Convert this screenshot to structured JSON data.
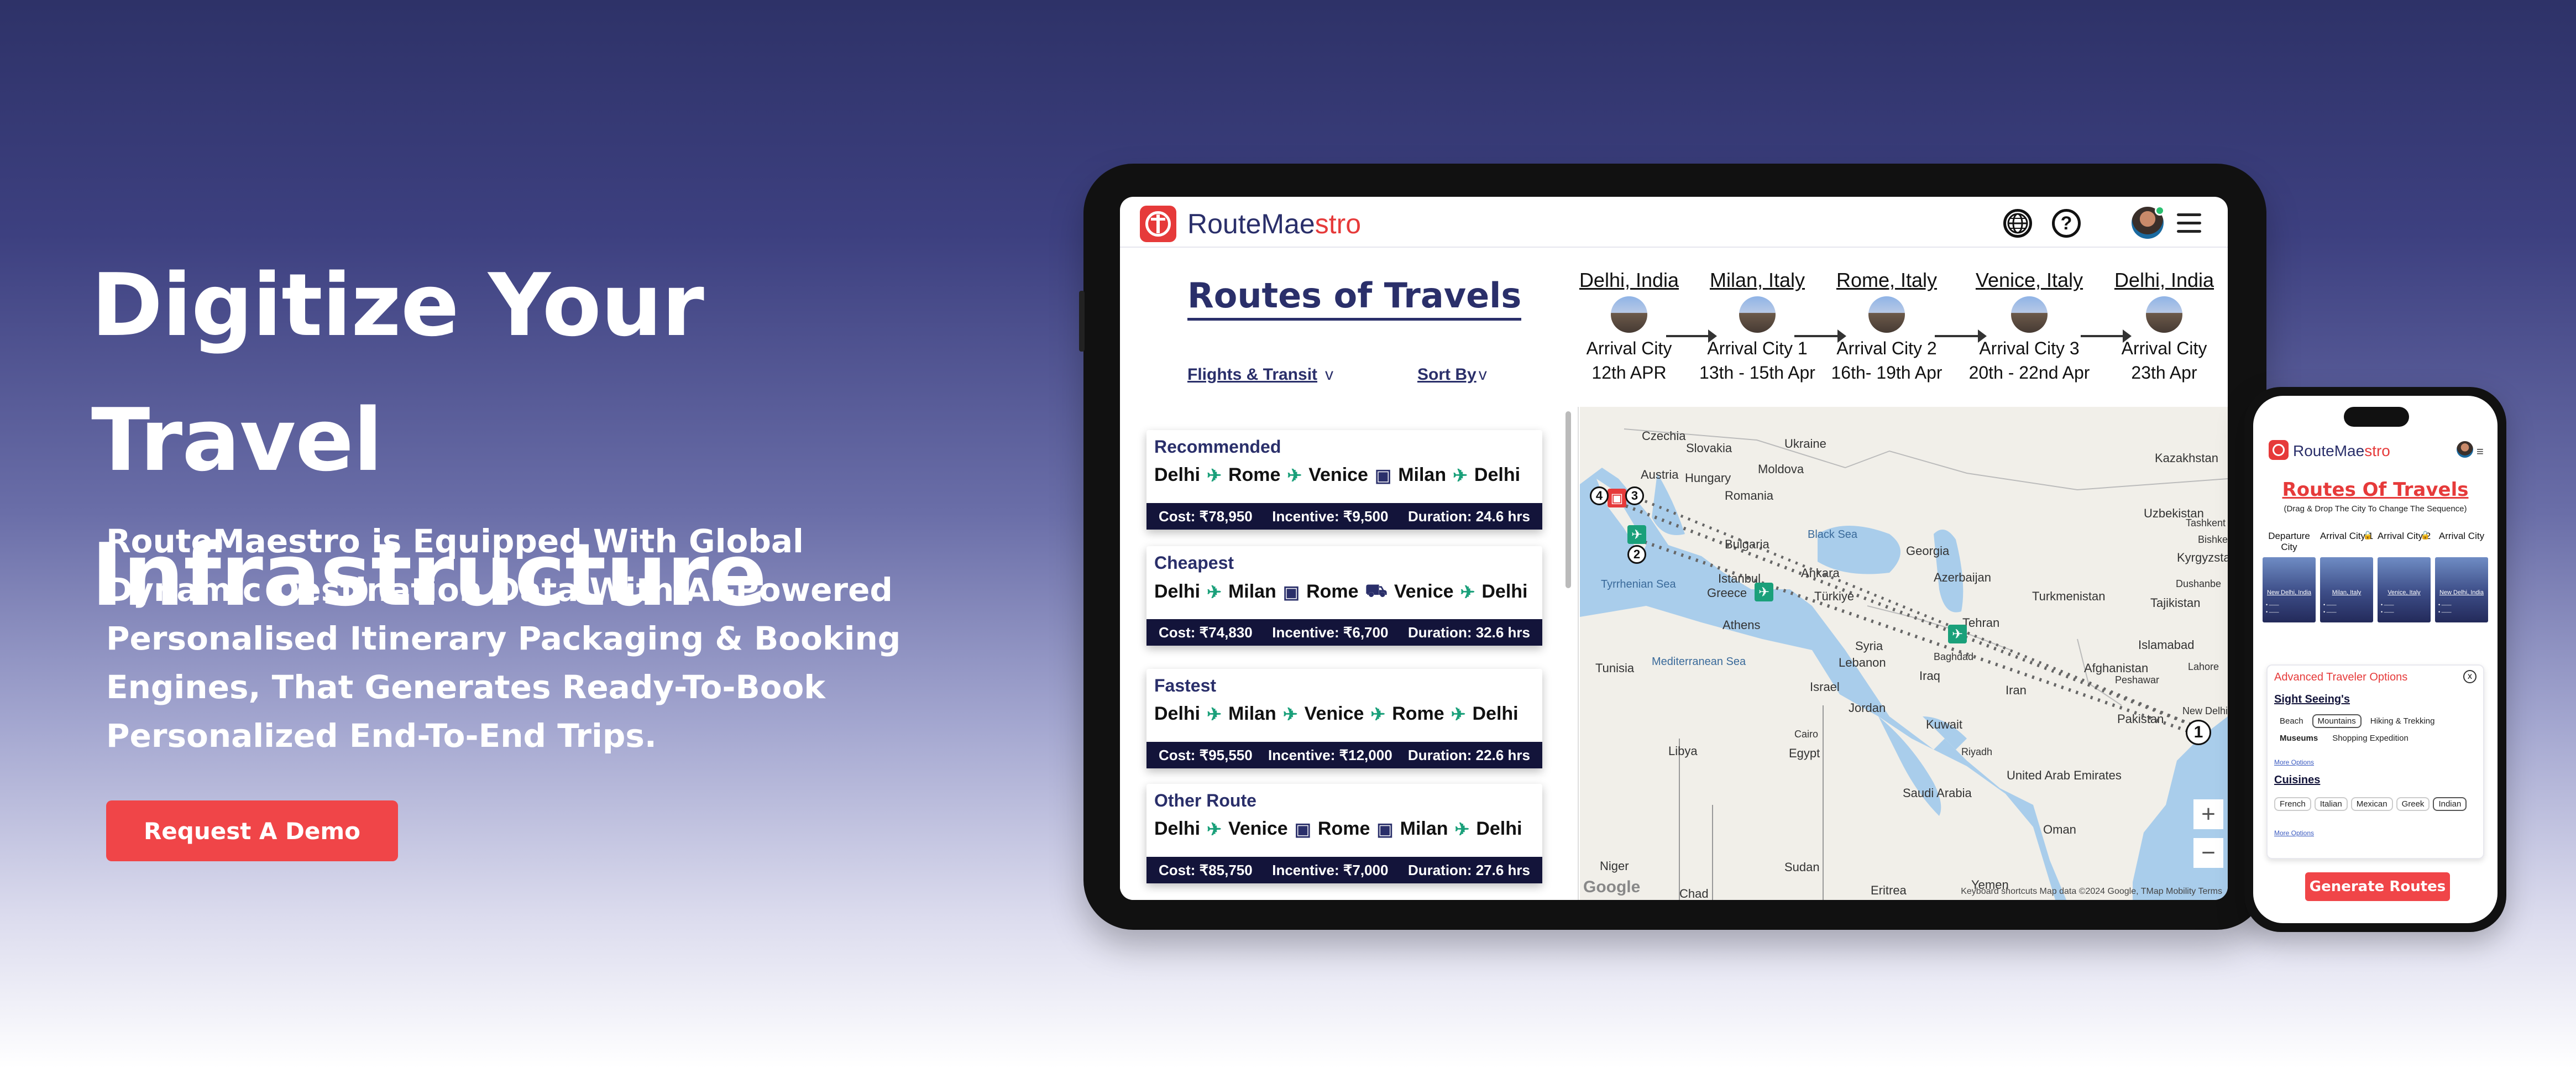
{
  "hero": {
    "title_line1": "Digitize Your",
    "title_line2": "Travel Infrastructure",
    "description": "RouteMaestro is Equipped With Global Dynamic Destination Data With AI-Powered Personalised Itinerary Packaging & Booking Engines, That Generates Ready-To-Book Personalized End-To-End Trips.",
    "cta_label": "Request A Demo"
  },
  "colors": {
    "accent": "#f04548",
    "navy": "#2a2f6a",
    "transit_green": "#1aa07a",
    "stats_bar": "#13143a"
  },
  "tablet": {
    "brand": {
      "part1": "RouteMae",
      "part2": "stro"
    },
    "header_icons": [
      "globe-icon",
      "help-icon",
      "avatar",
      "menu-icon"
    ],
    "help_glyph": "?",
    "page_title": "Routes of Travels",
    "filters": {
      "flights": "Flights & Transit",
      "sort": "Sort By",
      "chevron": "v"
    },
    "stops": [
      {
        "city": "Delhi, India",
        "role": "Arrival City",
        "dates": "12th APR"
      },
      {
        "city": "Milan, Italy",
        "role": "Arrival City 1",
        "dates": "13th - 15th Apr"
      },
      {
        "city": "Rome, Italy",
        "role": "Arrival City 2",
        "dates": "16th- 19th Apr"
      },
      {
        "city": "Venice, Italy",
        "role": "Arrival City 3",
        "dates": "20th - 22nd Apr"
      },
      {
        "city": "Delhi, India",
        "role": "Arrival City",
        "dates": "23th Apr"
      }
    ],
    "routes": [
      {
        "name": "Recommended",
        "cities": [
          "Delhi",
          "Rome",
          "Venice",
          "Milan",
          "Delhi"
        ],
        "modes": [
          "flight",
          "flight",
          "train",
          "flight"
        ],
        "cost": "Cost: ₹78,950",
        "incentive": "Incentive: ₹9,500",
        "duration": "Duration: 24.6 hrs"
      },
      {
        "name": "Cheapest",
        "cities": [
          "Delhi",
          "Milan",
          "Rome",
          "Venice",
          "Delhi"
        ],
        "modes": [
          "flight",
          "train",
          "bus",
          "flight"
        ],
        "cost": "Cost: ₹74,830",
        "incentive": "Incentive: ₹6,700",
        "duration": "Duration: 32.6 hrs"
      },
      {
        "name": "Fastest",
        "cities": [
          "Delhi",
          "Milan",
          "Venice",
          "Rome",
          "Delhi"
        ],
        "modes": [
          "flight",
          "flight",
          "flight",
          "flight"
        ],
        "cost": "Cost: ₹95,550",
        "incentive": "Incentive: ₹12,000",
        "duration": "Duration: 22.6 hrs"
      },
      {
        "name": "Other Route",
        "cities": [
          "Delhi",
          "Venice",
          "Rome",
          "Milan",
          "Delhi"
        ],
        "modes": [
          "flight",
          "train",
          "train",
          "flight"
        ],
        "cost": "Cost: ₹85,750",
        "incentive": "Incentive: ₹7,000",
        "duration": "Duration: 27.6 hrs"
      }
    ],
    "map": {
      "labels": [
        "Czechia",
        "Slovakia",
        "Ukraine",
        "Kazakhstan",
        "Austria",
        "Hungary",
        "Moldova",
        "Romania",
        "Uzbekistan",
        "Black Sea",
        "Georgia",
        "Kyrgyzstan",
        "Bulgaria",
        "Azerbaijan",
        "Tyrrhenian Sea",
        "Istanbul",
        "Ankara",
        "Türkiye",
        "Turkmenistan",
        "Tajikistan",
        "Greece",
        "Athens",
        "Tehran",
        "Tunisia",
        "Mediterranean Sea",
        "Syria",
        "Iraq",
        "Afghanistan",
        "Islamabad",
        "Lebanon",
        "Israel",
        "Jordan",
        "Iran",
        "Pakistan",
        "Kuwait",
        "Libya",
        "Egypt",
        "Saudi Arabia",
        "United Arab Emirates",
        "Oman",
        "Niger",
        "Chad",
        "Sudan",
        "Eritrea",
        "Yemen",
        "New Delhi",
        "Baghdad",
        "Cairo",
        "Riyadh",
        "Peshawar",
        "Tashkent",
        "Bishkek",
        "Dushanbe",
        "Lahore"
      ],
      "markers": [
        "1",
        "2",
        "3",
        "4"
      ],
      "zoom_in": "+",
      "zoom_out": "−",
      "google": "Google",
      "footer": "Keyboard shortcuts   Map data ©2024 Google, TMap Mobility   Terms"
    }
  },
  "phone": {
    "brand": {
      "part1": "RouteMae",
      "part2": "stro"
    },
    "title": "Routes Of Travels",
    "subtitle": "(Drag & Drop The City To Change The Sequence)",
    "cities": [
      {
        "label": "Departure City",
        "name": "New Delhi, India"
      },
      {
        "label": "Arrival City 1",
        "name": "Milan, Italy"
      },
      {
        "label": "Arrival City 2",
        "name": "Venice, Italy"
      },
      {
        "label": "Arrival City",
        "name": "New Delhi, India"
      }
    ],
    "options": {
      "title": "Advanced Traveler Options",
      "close": "x",
      "sight_seeing": "Sight Seeing's",
      "sight_chips": [
        "Beach",
        "Mountains",
        "Hiking & Trekking",
        "Museums",
        "Shopping Expedition"
      ],
      "more": "More Options",
      "cuisines": "Cuisines",
      "cuisine_chips": [
        "French",
        "Italian",
        "Mexican",
        "Greek",
        "Indian"
      ]
    },
    "generate": "Generate Routes"
  }
}
